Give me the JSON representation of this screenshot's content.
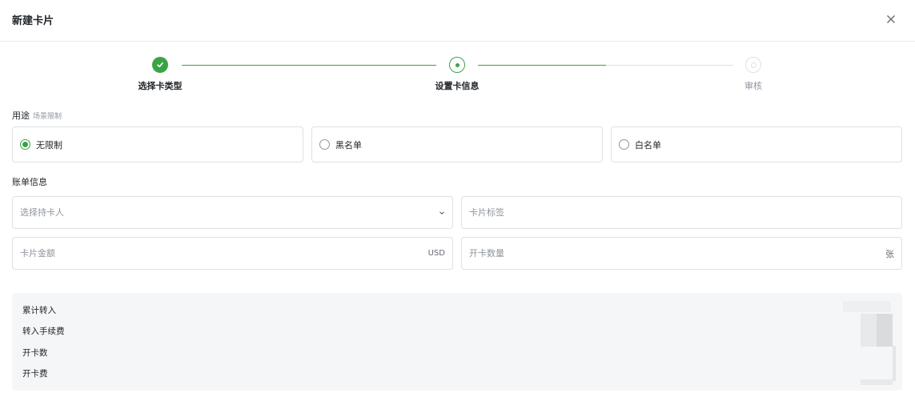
{
  "dialog": {
    "title": "新建卡片"
  },
  "steps": [
    {
      "label": "选择卡类型",
      "status": "done"
    },
    {
      "label": "设置卡信息",
      "status": "current"
    },
    {
      "label": "审核",
      "status": "pending"
    }
  ],
  "usage": {
    "title": "用途",
    "subtitle": "场景限制",
    "options": [
      {
        "label": "无限制",
        "checked": true
      },
      {
        "label": "黑名单",
        "checked": false
      },
      {
        "label": "白名单",
        "checked": false
      }
    ]
  },
  "billing": {
    "title": "账单信息",
    "cardholder": {
      "placeholder": "选择持卡人",
      "value": ""
    },
    "card_label": {
      "placeholder": "卡片标签",
      "value": ""
    },
    "card_amount": {
      "placeholder": "卡片金额",
      "value": "",
      "suffix": "USD"
    },
    "card_count": {
      "placeholder": "开卡数量",
      "value": "",
      "suffix": "张"
    }
  },
  "summary": {
    "rows": [
      {
        "label": "累计转入"
      },
      {
        "label": "转入手续费"
      },
      {
        "label": "开卡数"
      },
      {
        "label": "开卡费"
      }
    ]
  },
  "colors": {
    "accent": "#3aa345",
    "border": "#dee0e3",
    "muted": "#8f959e"
  },
  "icons": {
    "close": "close-icon",
    "done": "check-icon",
    "select": "chevron-down-icon"
  }
}
